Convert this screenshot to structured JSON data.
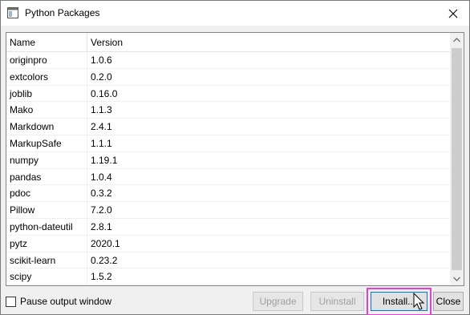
{
  "window": {
    "title": "Python Packages",
    "close_glyph": "✕",
    "icon": "app-window-icon"
  },
  "table": {
    "columns": [
      "Name",
      "Version"
    ],
    "rows": [
      {
        "name": "originpro",
        "version": "1.0.6"
      },
      {
        "name": "extcolors",
        "version": "0.2.0"
      },
      {
        "name": "joblib",
        "version": "0.16.0"
      },
      {
        "name": "Mako",
        "version": "1.1.3"
      },
      {
        "name": "Markdown",
        "version": "2.4.1"
      },
      {
        "name": "MarkupSafe",
        "version": "1.1.1"
      },
      {
        "name": "numpy",
        "version": "1.19.1"
      },
      {
        "name": "pandas",
        "version": "1.0.4"
      },
      {
        "name": "pdoc",
        "version": "0.3.2"
      },
      {
        "name": "Pillow",
        "version": "7.2.0"
      },
      {
        "name": "python-dateutil",
        "version": "2.8.1"
      },
      {
        "name": "pytz",
        "version": "2020.1"
      },
      {
        "name": "scikit-learn",
        "version": "0.23.2"
      },
      {
        "name": "scipy",
        "version": "1.5.2"
      }
    ]
  },
  "footer": {
    "pause_label": "Pause output window",
    "pause_checked": false,
    "upgrade_label": "Upgrade",
    "uninstall_label": "Uninstall",
    "install_label": "Install...",
    "close_label": "Close"
  },
  "colors": {
    "highlight": "#e83ed8",
    "focus_border": "#0078d7",
    "disabled_text": "#a0a0a0"
  }
}
